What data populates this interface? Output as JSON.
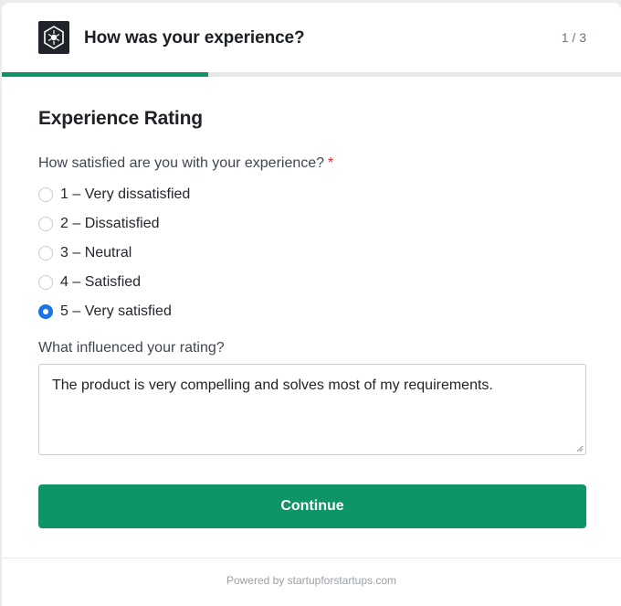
{
  "header": {
    "title": "How was your experience?",
    "step": "1 / 3",
    "logo_icon": "hexagon-logo-icon"
  },
  "progress": {
    "fraction": 0.333,
    "color": "#0f9467"
  },
  "section": {
    "title": "Experience Rating"
  },
  "question1": {
    "label": "How satisfied are you with your experience?",
    "required_mark": "*",
    "options": [
      {
        "label": "1 – Very dissatisfied",
        "checked": false
      },
      {
        "label": "2 – Dissatisfied",
        "checked": false
      },
      {
        "label": "3 – Neutral",
        "checked": false
      },
      {
        "label": "4 – Satisfied",
        "checked": false
      },
      {
        "label": "5 – Very satisfied",
        "checked": true
      }
    ]
  },
  "question2": {
    "label": "What influenced your rating?",
    "value": "The product is very compelling and solves most of my requirements."
  },
  "actions": {
    "continue_label": "Continue",
    "accent": "#0f9467"
  },
  "footer": {
    "text": "Powered by startupforstartups.com"
  }
}
